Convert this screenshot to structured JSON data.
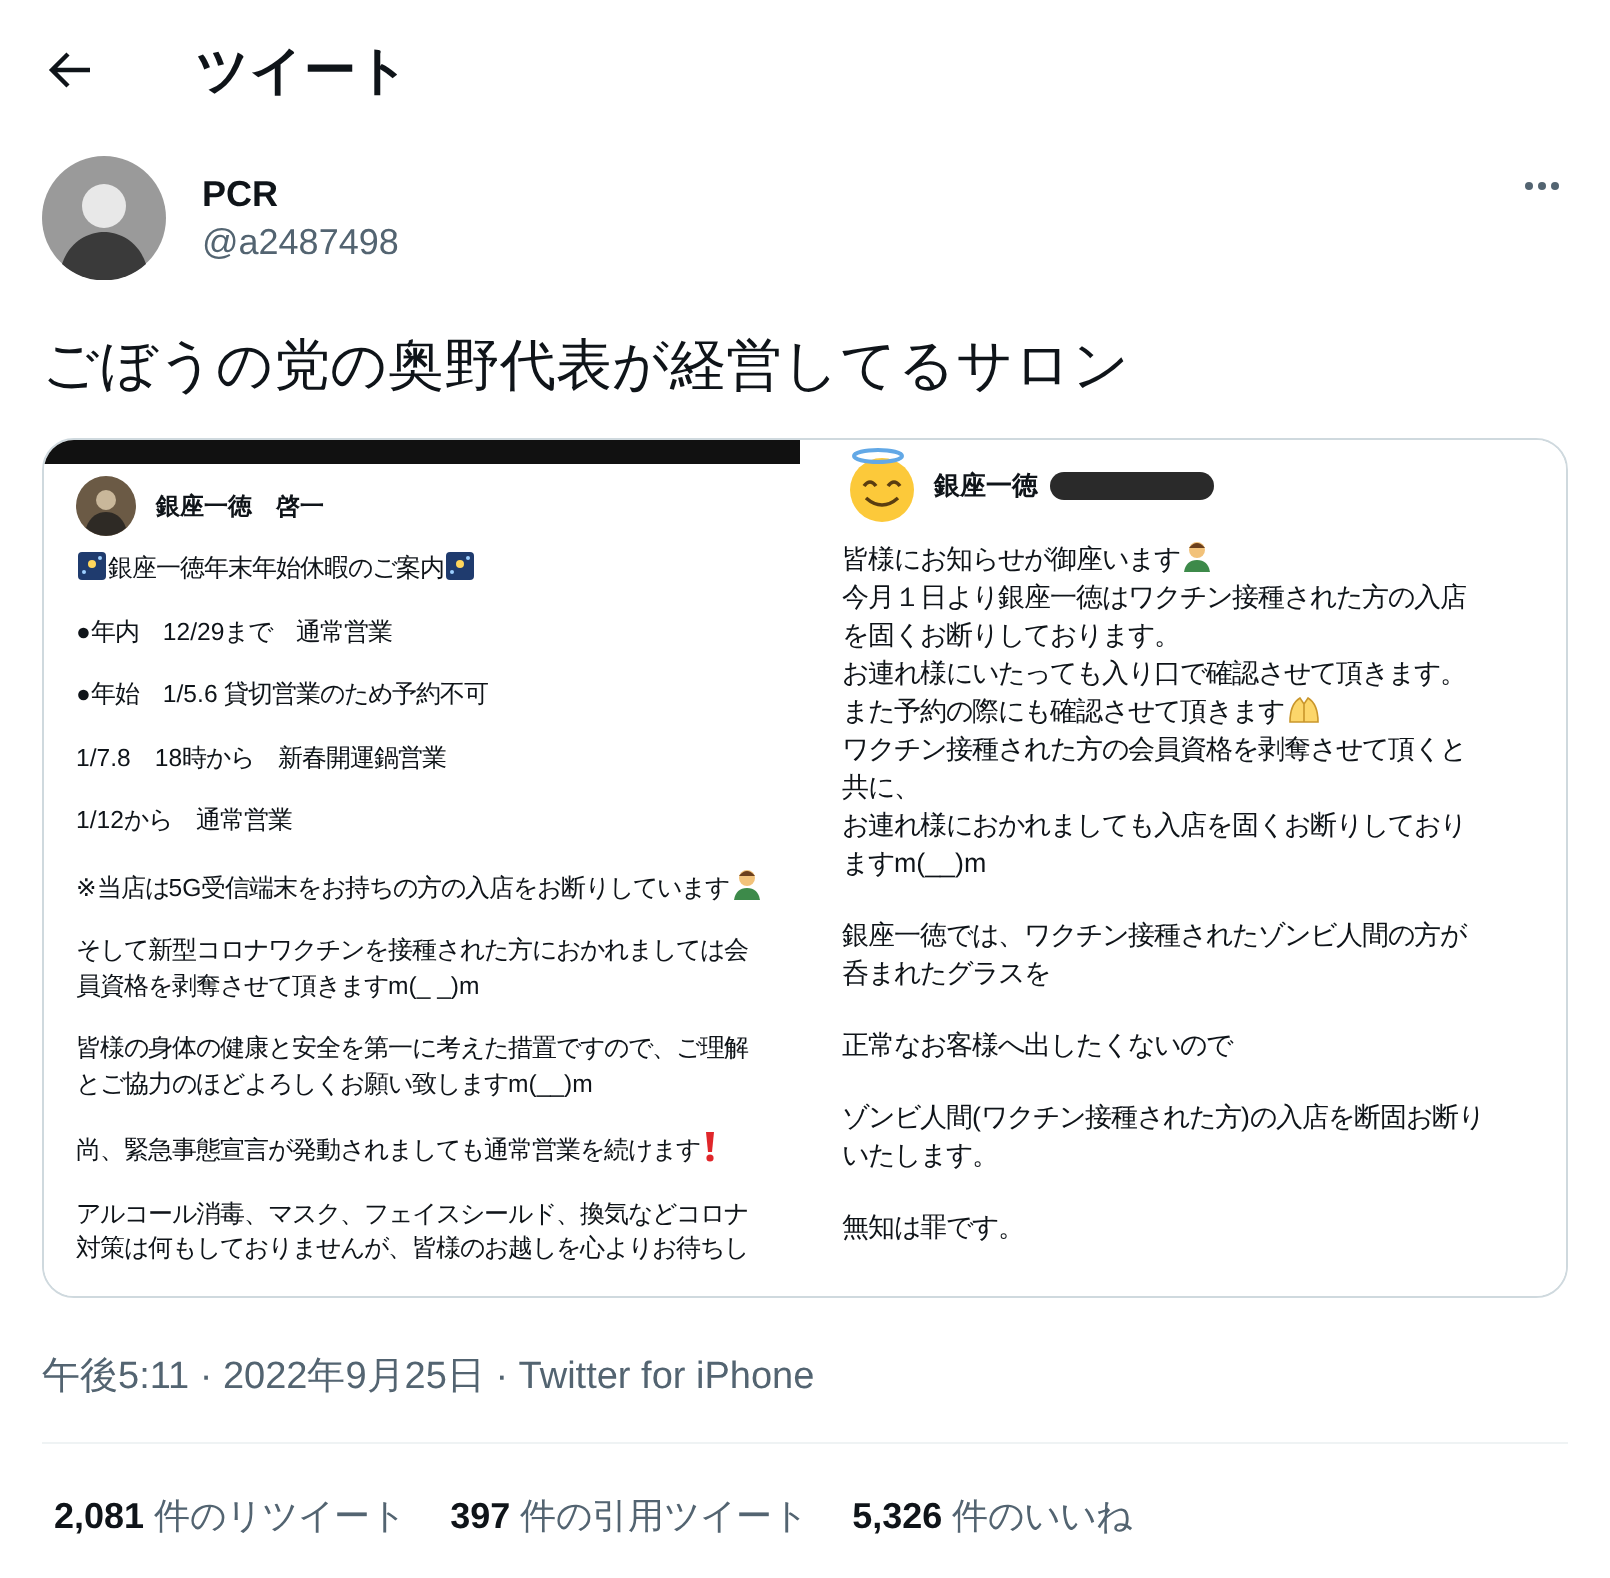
{
  "header": {
    "title": "ツイート"
  },
  "tweet": {
    "author": {
      "name": "PCR",
      "handle": "@a2487498"
    },
    "text": "ごぼうの党の奥野代表が経営してるサロン",
    "images": [
      {
        "avatar": {
          "kind": "photo"
        },
        "author": "銀座一徳　啓一",
        "redacted": false,
        "paragraphs": [
          {
            "lines": [
              {
                "text": "銀座一徳年末年始休暇のご案内",
                "icon_start": {
                  "kind": "sky"
                },
                "icon_end": {
                  "kind": "sky"
                }
              }
            ]
          },
          {
            "lines": [
              {
                "text": "●年内　12/29まで　通常営業"
              }
            ]
          },
          {
            "lines": [
              {
                "text": "●年始　1/5.6  貸切営業のため予約不可"
              }
            ]
          },
          {
            "lines": [
              {
                "text": "1/7.8　18時から　新春開運鍋営業"
              }
            ]
          },
          {
            "lines": [
              {
                "text": "1/12から　通常営業"
              }
            ]
          },
          {
            "lines": [
              {
                "text": "※当店は5G受信端末をお持ちの方の入店をお断りしています",
                "icon_end": {
                  "kind": "person"
                }
              }
            ]
          },
          {
            "lines": [
              {
                "text": "そして新型コロナワクチンを接種された方におかれましては会員資格を剥奪させて頂きますm(_ _)m"
              }
            ]
          },
          {
            "lines": [
              {
                "text": "皆様の身体の健康と安全を第一に考えた措置ですので、ご理解とご協力のほどよろしくお願い致しますm(__)m"
              }
            ]
          },
          {
            "lines": [
              {
                "text": "尚、緊急事態宣言が発動されましても通常営業を続けます",
                "icon_end": {
                  "kind": "exclamation"
                }
              }
            ]
          },
          {
            "lines": [
              {
                "text": "アルコール消毒、マスク、フェイスシールド、換気などコロナ対策は何もしておりませんが、皆様のお越しを心よりお待ちし"
              }
            ]
          }
        ]
      },
      {
        "avatar": {
          "kind": "smiley"
        },
        "author": "銀座一徳",
        "redacted": true,
        "paragraphs": [
          {
            "lines": [
              {
                "text": "皆様にお知らせが御座います",
                "icon_end": {
                  "kind": "person"
                }
              },
              {
                "text": "今月１日より銀座一徳はワクチン接種された方の入店を固くお断りしております。"
              },
              {
                "text": "お連れ様にいたっても入り口で確認させて頂きます。"
              },
              {
                "text": "また予約の際にも確認させて頂きます",
                "icon_end": {
                  "kind": "hands"
                }
              },
              {
                "text": "ワクチン接種された方の会員資格を剥奪させて頂くと共に、"
              },
              {
                "text": "お連れ様におかれましても入店を固くお断りしておりますm(__)m"
              }
            ]
          },
          {
            "lines": [
              {
                "text": "銀座一徳では、ワクチン接種されたゾンビ人間の方が呑まれたグラスを"
              }
            ]
          },
          {
            "lines": [
              {
                "text": "正常なお客様へ出したくないので"
              }
            ]
          },
          {
            "lines": [
              {
                "text": "ゾンビ人間(ワクチン接種された方)の入店を断固お断りいたします。"
              }
            ]
          },
          {
            "lines": [
              {
                "text": "無知は罪です。"
              }
            ]
          }
        ]
      }
    ],
    "meta": "午後5:11 · 2022年9月25日 · Twitter for iPhone",
    "stats": [
      {
        "count": "2,081",
        "label": "件のリツイート"
      },
      {
        "count": "397",
        "label": "件の引用ツイート"
      },
      {
        "count": "5,326",
        "label": "件のいいね"
      }
    ]
  }
}
